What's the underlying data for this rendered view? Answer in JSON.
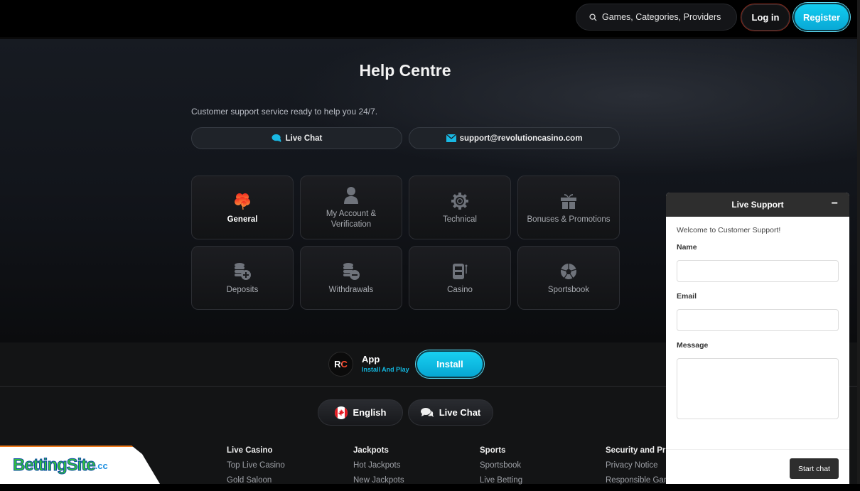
{
  "header": {
    "search_placeholder": "Games, Categories, Providers",
    "login_label": "Log in",
    "register_label": "Register"
  },
  "help": {
    "title": "Help Centre",
    "subtitle": "Customer support service ready to help you 24/7.",
    "live_chat_label": "Live Chat",
    "email_label": "support@revolutioncasino.com",
    "categories": [
      {
        "label": "General",
        "icon": "clover-icon",
        "active": true
      },
      {
        "label": "My Account & Verification",
        "icon": "user-icon"
      },
      {
        "label": "Technical",
        "icon": "gear-icon"
      },
      {
        "label": "Bonuses & Promotions",
        "icon": "gift-icon"
      },
      {
        "label": "Deposits",
        "icon": "coins-plus-icon"
      },
      {
        "label": "Withdrawals",
        "icon": "coins-minus-icon"
      },
      {
        "label": "Casino",
        "icon": "slot-machine-icon"
      },
      {
        "label": "Sportsbook",
        "icon": "soccer-ball-icon"
      }
    ]
  },
  "app_banner": {
    "logo_text": "RC",
    "title": "App",
    "subtitle": "Install And Play",
    "install_label": "Install"
  },
  "footer": {
    "language_label": "English",
    "live_chat_label": "Live Chat",
    "columns": [
      {
        "heading": "Live Casino",
        "links": [
          "Top Live Casino",
          "Gold Saloon"
        ]
      },
      {
        "heading": "Jackpots",
        "links": [
          "Hot Jackpots",
          "New Jackpots"
        ]
      },
      {
        "heading": "Sports",
        "links": [
          "Sportsbook",
          "Live Betting"
        ]
      },
      {
        "heading": "Security and Privacy",
        "links": [
          "Privacy Notice",
          "Responsible Gaming"
        ]
      }
    ]
  },
  "watermark": {
    "text": "BettingSite",
    "suffix": ".cc"
  },
  "chat_widget": {
    "title": "Live Support",
    "minimize": "−",
    "welcome": "Welcome to Customer Support!",
    "name_label": "Name",
    "email_label": "Email",
    "message_label": "Message",
    "start_label": "Start chat"
  },
  "colors": {
    "accent": "#12c4ea",
    "login_border": "#8a2a1c",
    "clover": "#f5412a"
  }
}
